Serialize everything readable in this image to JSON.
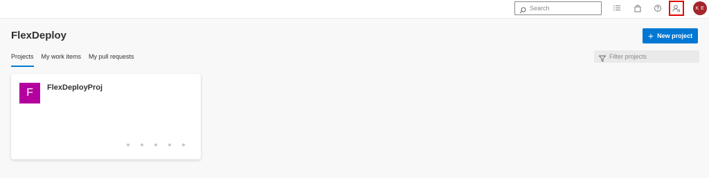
{
  "header": {
    "search_placeholder": "Search",
    "avatar_initials": "K E",
    "icons": [
      "list-icon",
      "shopping-bag-icon",
      "help-icon",
      "user-settings-icon"
    ]
  },
  "page": {
    "title": "FlexDeploy",
    "new_project_label": "New project",
    "tabs": [
      {
        "label": "Projects",
        "active": true
      },
      {
        "label": "My work items",
        "active": false
      },
      {
        "label": "My pull requests",
        "active": false
      }
    ],
    "filter_placeholder": "Filter projects"
  },
  "projects": [
    {
      "initial": "F",
      "name": "FlexDeployProj",
      "color": "#b4009e"
    }
  ],
  "colors": {
    "accent": "#0078d4",
    "avatar_bg": "#a4262c",
    "highlight_border": "#e00000"
  }
}
